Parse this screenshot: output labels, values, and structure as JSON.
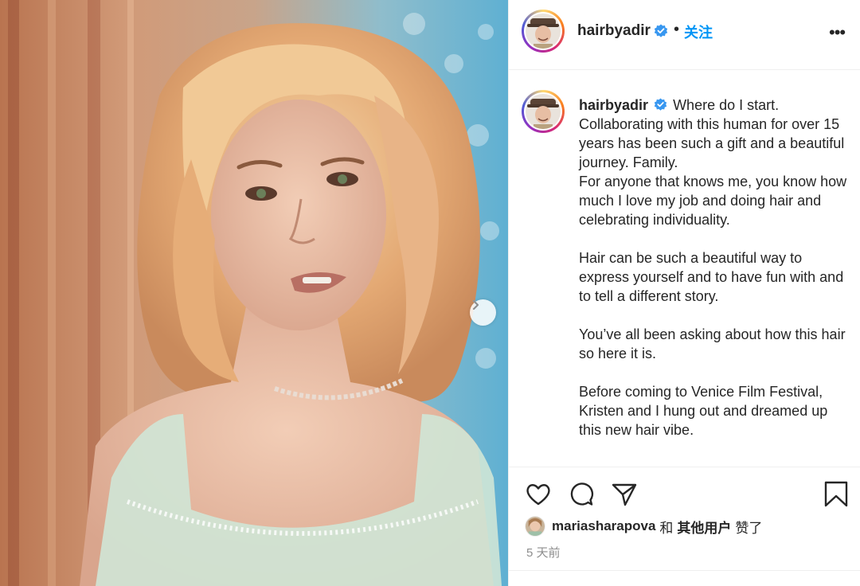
{
  "post": {
    "username": "hairbyadir",
    "follow_label": "关注",
    "more_label": "•••",
    "caption_lines": [
      "Where do I start.",
      "Collaborating with this human for over 15 years has been such a gift and a beautiful journey. Family.",
      "For anyone that knows me, you know how much I love my job and doing hair and celebrating individuality.",
      "",
      "Hair can be such a beautiful way to express yourself and to have fun with and to tell a different story.",
      "",
      "You’ve all been asking about how this hair so here it is.",
      "",
      "Before coming to Venice Film Festival, Kristen and I hung out and dreamed up this new hair vibe."
    ],
    "likes": {
      "user": "mariasharapova",
      "and": "和",
      "others": "其他用户",
      "liked": "赞了"
    },
    "time": "5 天前"
  },
  "icons": {
    "verified": "verified-badge-icon",
    "next": "chevron-right-icon",
    "like": "heart-icon",
    "comment": "comment-bubble-icon",
    "share": "paper-plane-icon",
    "save": "bookmark-icon"
  },
  "colors": {
    "link_blue": "#0095f6",
    "verified_blue": "#3897f0",
    "text": "#262626",
    "muted": "#8e8e8e",
    "divider": "#efefef"
  }
}
